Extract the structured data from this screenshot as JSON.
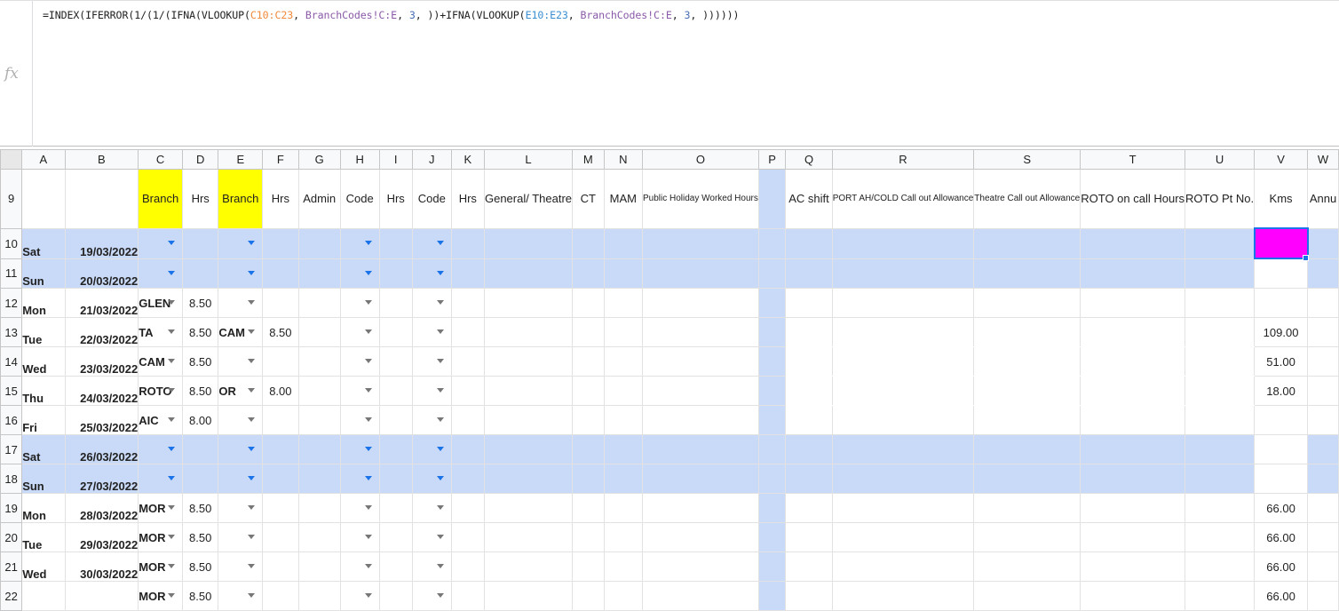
{
  "formula": {
    "fx_label": "fx",
    "p1": "=INDEX(IFERROR(1/(1/(IFNA(VLOOKUP(",
    "ref1": "C10:C23",
    "p2": ", ",
    "ref2": "BranchCodes!C:E",
    "p3": ", ",
    "n1": "3",
    "p4": ", ))+IFNA(VLOOKUP(",
    "ref3": "E10:E23",
    "p5": ", ",
    "ref4": "BranchCodes!C:E",
    "p6": ", ",
    "n2": "3",
    "p7": ", ))))))"
  },
  "columns": [
    "A",
    "B",
    "C",
    "D",
    "E",
    "F",
    "G",
    "H",
    "I",
    "J",
    "K",
    "L",
    "M",
    "N",
    "O",
    "P",
    "Q",
    "R",
    "S",
    "T",
    "U",
    "V",
    "W"
  ],
  "header_row": {
    "row_num": "9",
    "labels": [
      "",
      "",
      "Branch",
      "Hrs",
      "Branch",
      "Hrs",
      "Admin",
      "Code",
      "Hrs",
      "Code",
      "Hrs",
      "General/ Theatre",
      "CT",
      "MAM",
      "Public Holiday Worked Hours",
      "",
      "AC shift",
      "PORT AH/COLD Call out Allowance",
      "Theatre Call out Allowance",
      "ROTO on call Hours",
      "ROTO Pt No.",
      "Kms",
      "Annu"
    ]
  },
  "rows": [
    {
      "num": "10",
      "day": "Sat",
      "date": "19/03/2022",
      "c": "",
      "d": "",
      "e": "",
      "f": "",
      "v": ""
    },
    {
      "num": "11",
      "day": "Sun",
      "date": "20/03/2022",
      "c": "",
      "d": "",
      "e": "",
      "f": "",
      "v": ""
    },
    {
      "num": "12",
      "day": "Mon",
      "date": "21/03/2022",
      "c": "GLEN",
      "d": "8.50",
      "e": "",
      "f": "",
      "v": ""
    },
    {
      "num": "13",
      "day": "Tue",
      "date": "22/03/2022",
      "c": "TA",
      "d": "8.50",
      "e": "CAM",
      "f": "8.50",
      "v": "109.00"
    },
    {
      "num": "14",
      "day": "Wed",
      "date": "23/03/2022",
      "c": "CAM",
      "d": "8.50",
      "e": "",
      "f": "",
      "v": "51.00"
    },
    {
      "num": "15",
      "day": "Thu",
      "date": "24/03/2022",
      "c": "ROTO",
      "d": "8.50",
      "e": "OR",
      "f": "8.00",
      "v": "18.00"
    },
    {
      "num": "16",
      "day": "Fri",
      "date": "25/03/2022",
      "c": "AIC",
      "d": "8.00",
      "e": "",
      "f": "",
      "v": ""
    },
    {
      "num": "17",
      "day": "Sat",
      "date": "26/03/2022",
      "c": "",
      "d": "",
      "e": "",
      "f": "",
      "v": ""
    },
    {
      "num": "18",
      "day": "Sun",
      "date": "27/03/2022",
      "c": "",
      "d": "",
      "e": "",
      "f": "",
      "v": ""
    },
    {
      "num": "19",
      "day": "Mon",
      "date": "28/03/2022",
      "c": "MOR",
      "d": "8.50",
      "e": "",
      "f": "",
      "v": "66.00"
    },
    {
      "num": "20",
      "day": "Tue",
      "date": "29/03/2022",
      "c": "MOR",
      "d": "8.50",
      "e": "",
      "f": "",
      "v": "66.00"
    },
    {
      "num": "21",
      "day": "Wed",
      "date": "30/03/2022",
      "c": "MOR",
      "d": "8.50",
      "e": "",
      "f": "",
      "v": "66.00"
    },
    {
      "num": "22",
      "day": "",
      "date": "",
      "c": "MOR",
      "d": "8.50",
      "e": "",
      "f": "",
      "v": "66.00"
    }
  ],
  "colors": {
    "weekend": "#c9daf8",
    "branch_header": "#ffff00",
    "selected_cell": "#ff00ff",
    "accent": "#1a73e8"
  }
}
